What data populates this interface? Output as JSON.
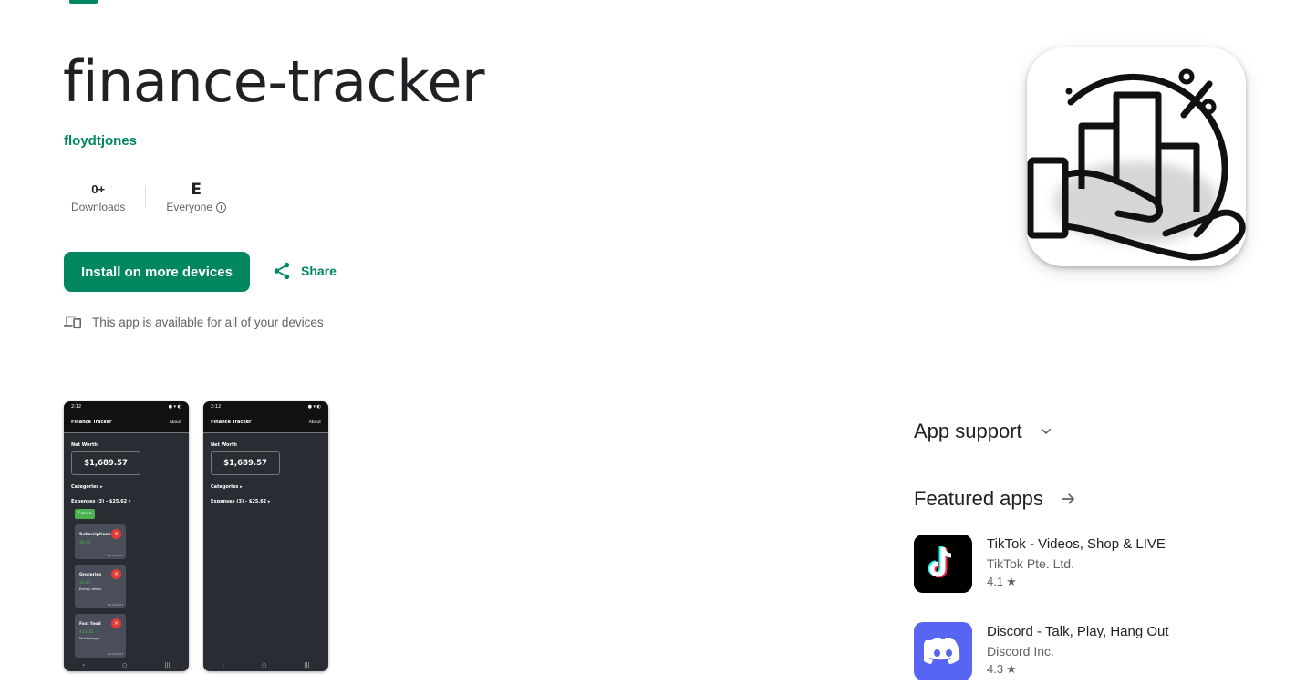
{
  "app": {
    "title": "finance-tracker",
    "developer": "floydtjones",
    "downloads_value": "0+",
    "downloads_label": "Downloads",
    "rating_badge": "E",
    "rating_label": "Everyone"
  },
  "actions": {
    "install_label": "Install on more devices",
    "share_label": "Share",
    "availability_text": "This app is available for all of your devices"
  },
  "screenshots": [
    {
      "time": "2:12",
      "app_title": "Finance Tracker",
      "about": "About",
      "net_worth_label": "Net Worth",
      "net_worth": "$1,689.57",
      "categories": "Categories ▸",
      "expenses": "Expenses (3) - $25.62 ▾",
      "create": "Create",
      "cards": [
        {
          "title": "Subscriptions",
          "amount": "$6.62",
          "sub": "",
          "date": "11/14/2023"
        },
        {
          "title": "Groceries",
          "amount": "$5.65",
          "sub": "Energy drinks",
          "date": "11/14/2023"
        },
        {
          "title": "Fast food",
          "amount": "$13.35",
          "sub": "Whataburger",
          "date": "11/14/2023"
        }
      ]
    },
    {
      "time": "2:12",
      "app_title": "Finance Tracker",
      "about": "About",
      "net_worth_label": "Net Worth",
      "net_worth": "$1,689.57",
      "categories": "Categories ▸",
      "expenses": "Expenses (3) - $25.62 ▸"
    }
  ],
  "sidebar": {
    "app_support": "App support",
    "featured_apps": "Featured apps",
    "apps": [
      {
        "name": "TikTok - Videos, Shop & LIVE",
        "developer": "TikTok Pte. Ltd.",
        "rating": "4.1",
        "icon": "tiktok-icon"
      },
      {
        "name": "Discord - Talk, Play, Hang Out",
        "developer": "Discord Inc.",
        "rating": "4.3",
        "icon": "discord-icon"
      }
    ]
  },
  "colors": {
    "accent": "#01875f",
    "discord": "#5865f2",
    "tiktok": "#000000"
  }
}
